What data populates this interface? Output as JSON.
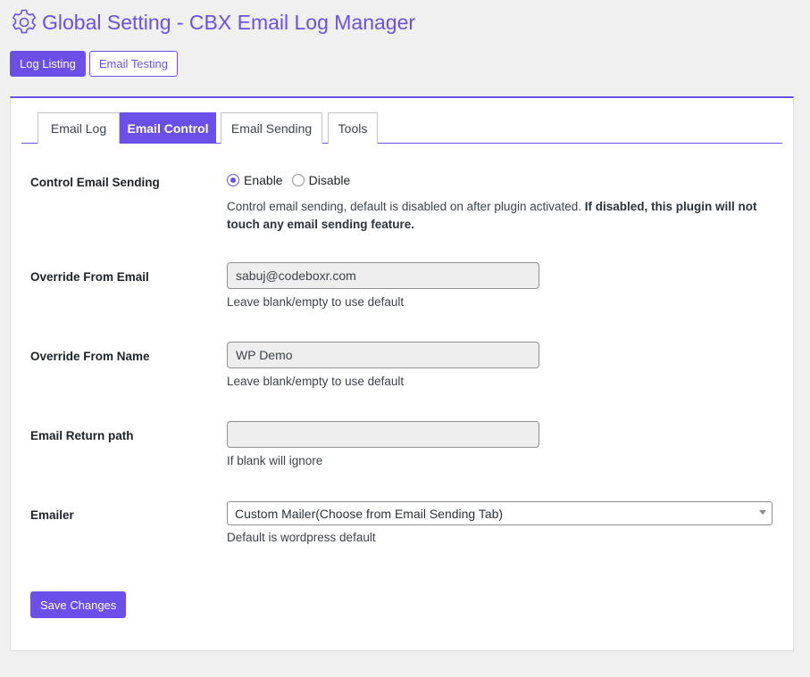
{
  "header": {
    "title": "Global Setting - CBX Email Log Manager",
    "icon": "gear-icon",
    "accent_color": "#6c4fe8"
  },
  "top_buttons": {
    "log_listing": "Log Listing",
    "email_testing": "Email Testing"
  },
  "tabs": [
    {
      "label": "Email Log",
      "active": false
    },
    {
      "label": "Email Control",
      "active": true
    },
    {
      "label": "Email Sending",
      "active": false
    },
    {
      "label": "Tools",
      "active": false
    }
  ],
  "settings": {
    "control_sending": {
      "label": "Control Email Sending",
      "option_enable": "Enable",
      "option_disable": "Disable",
      "selected": "Enable",
      "desc_text": "Control email sending, default is disabled on after plugin activated.",
      "desc_bold": "If disabled, this plugin will not touch any email sending feature."
    },
    "from_email": {
      "label": "Override From Email",
      "value": "sabuj@codeboxr.com",
      "desc": "Leave blank/empty to use default"
    },
    "from_name": {
      "label": "Override From Name",
      "value": "WP Demo",
      "desc": "Leave blank/empty to use default"
    },
    "return_path": {
      "label": "Email Return path",
      "value": "",
      "desc": "If blank will ignore"
    },
    "emailer": {
      "label": "Emailer",
      "selected": "Custom Mailer(Choose from Email Sending Tab)",
      "desc": "Default is wordpress default"
    }
  },
  "save_button": "Save Changes"
}
